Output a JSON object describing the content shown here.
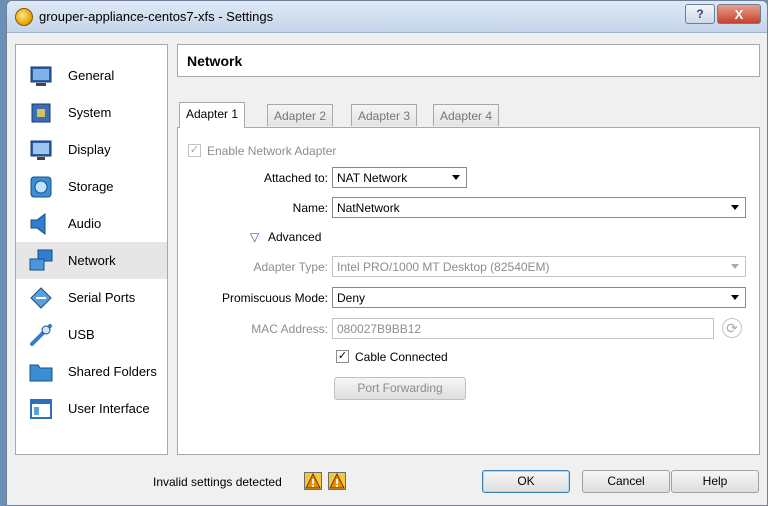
{
  "window": {
    "title": "grouper-appliance-centos7-xfs - Settings",
    "help_glyph": "?",
    "close_glyph": "X"
  },
  "sidebar": {
    "items": [
      {
        "label": "General",
        "icon": "general-icon"
      },
      {
        "label": "System",
        "icon": "system-icon"
      },
      {
        "label": "Display",
        "icon": "display-icon"
      },
      {
        "label": "Storage",
        "icon": "storage-icon"
      },
      {
        "label": "Audio",
        "icon": "audio-icon"
      },
      {
        "label": "Network",
        "icon": "network-icon",
        "selected": true
      },
      {
        "label": "Serial Ports",
        "icon": "serial-ports-icon"
      },
      {
        "label": "USB",
        "icon": "usb-icon"
      },
      {
        "label": "Shared Folders",
        "icon": "shared-folders-icon"
      },
      {
        "label": "User Interface",
        "icon": "user-interface-icon"
      }
    ]
  },
  "page": {
    "title": "Network"
  },
  "tabs": [
    {
      "label": "Adapter 1",
      "active": true
    },
    {
      "label": "Adapter 2"
    },
    {
      "label": "Adapter 3"
    },
    {
      "label": "Adapter 4"
    }
  ],
  "adapter": {
    "enable_label": "Enable Network Adapter",
    "enable_checked": true,
    "enable_check_glyph": "✓",
    "attached_label": "Attached to:",
    "attached_value": "NAT Network",
    "name_label": "Name:",
    "name_value": "NatNetwork",
    "advanced_label": "Advanced",
    "advanced_expanded": true,
    "advanced_glyph": "▽",
    "adapter_type_label": "Adapter Type:",
    "adapter_type_value": "Intel PRO/1000 MT Desktop (82540EM)",
    "promiscuous_label": "Promiscuous Mode:",
    "promiscuous_value": "Deny",
    "mac_label": "MAC Address:",
    "mac_value": "080027B9BB12",
    "refresh_glyph": "⟳",
    "cable_connected_label": "Cable Connected",
    "cable_connected_checked": true,
    "cable_check_glyph": "✓",
    "port_forwarding_label": "Port Forwarding"
  },
  "footer": {
    "status_text": "Invalid settings detected",
    "ok_label": "OK",
    "cancel_label": "Cancel",
    "help_label": "Help"
  },
  "colors": {
    "selected_item": "#e6e6e6",
    "disabled_text": "#8d8d8d",
    "warning": "#f3c640"
  }
}
